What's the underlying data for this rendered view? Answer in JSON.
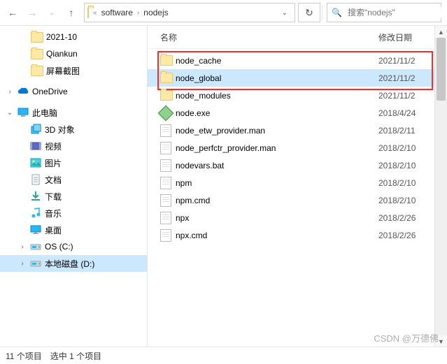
{
  "toolbar": {
    "breadcrumb": [
      "software",
      "nodejs"
    ],
    "search_placeholder": "搜索\"nodejs\""
  },
  "tree": {
    "recent": [
      {
        "label": "2021-10",
        "icon": "folder"
      },
      {
        "label": "Qiankun",
        "icon": "folder"
      },
      {
        "label": "屏幕截图",
        "icon": "folder"
      }
    ],
    "onedrive": {
      "label": "OneDrive"
    },
    "thispc": {
      "label": "此电脑"
    },
    "pc_items": [
      {
        "label": "3D 对象",
        "icon": "3d"
      },
      {
        "label": "视频",
        "icon": "video"
      },
      {
        "label": "图片",
        "icon": "pictures"
      },
      {
        "label": "文档",
        "icon": "documents"
      },
      {
        "label": "下载",
        "icon": "downloads"
      },
      {
        "label": "音乐",
        "icon": "music"
      },
      {
        "label": "桌面",
        "icon": "desktop"
      },
      {
        "label": "OS (C:)",
        "icon": "drive"
      },
      {
        "label": "本地磁盘 (D:)",
        "icon": "drive",
        "selected": true
      }
    ]
  },
  "columns": {
    "name": "名称",
    "date": "修改日期"
  },
  "files": [
    {
      "name": "node_cache",
      "type": "folder",
      "date": "2021/11/2"
    },
    {
      "name": "node_global",
      "type": "folder",
      "date": "2021/11/2",
      "selected": true
    },
    {
      "name": "node_modules",
      "type": "folder",
      "date": "2021/11/2"
    },
    {
      "name": "node.exe",
      "type": "exe",
      "date": "2018/4/24"
    },
    {
      "name": "node_etw_provider.man",
      "type": "file",
      "date": "2018/2/11"
    },
    {
      "name": "node_perfctr_provider.man",
      "type": "file",
      "date": "2018/2/10"
    },
    {
      "name": "nodevars.bat",
      "type": "file",
      "date": "2018/2/10"
    },
    {
      "name": "npm",
      "type": "file",
      "date": "2018/2/10"
    },
    {
      "name": "npm.cmd",
      "type": "file",
      "date": "2018/2/10"
    },
    {
      "name": "npx",
      "type": "file",
      "date": "2018/2/26"
    },
    {
      "name": "npx.cmd",
      "type": "file",
      "date": "2018/2/26"
    }
  ],
  "status": {
    "count": "11 个项目",
    "selected": "选中 1 个项目"
  },
  "watermark": "CSDN @万德佛"
}
